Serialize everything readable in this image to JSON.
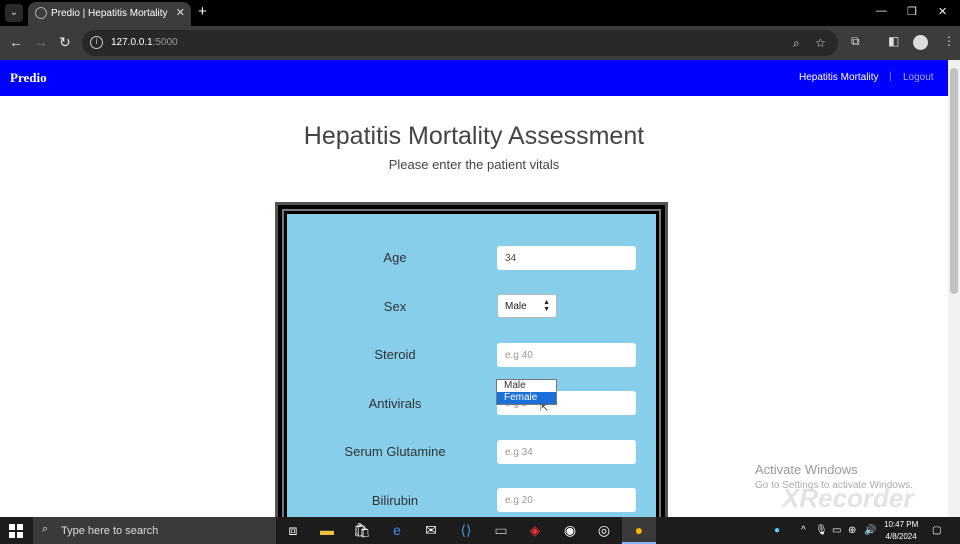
{
  "browser": {
    "tab_title": "Predio | Hepatitis Mortality Assessment",
    "url_host": "127.0.0.1",
    "url_port": ":5000",
    "new_tab": "+",
    "close": "✕"
  },
  "navbar": {
    "brand": "Predio",
    "link_assessment": "Hepatitis Mortality",
    "separator": "|",
    "link_logout": "Logout"
  },
  "page": {
    "title": "Hepatitis Mortality Assessment",
    "subtitle": "Please enter the patient vitals"
  },
  "form": {
    "age": {
      "label": "Age",
      "value": "34"
    },
    "sex": {
      "label": "Sex",
      "selected": "Male",
      "options": [
        "Male",
        "Female"
      ],
      "highlighted": "Female"
    },
    "steroid": {
      "label": "Steroid",
      "placeholder": "e.g 40"
    },
    "antivirals": {
      "label": "Antivirals",
      "placeholder": "e.g 5"
    },
    "serum_glutamine": {
      "label": "Serum Glutamine",
      "placeholder": "e.g 34"
    },
    "bilirubin": {
      "label": "Bilirubin",
      "placeholder": "e.g 20"
    }
  },
  "watermark": {
    "activate_title": "Activate Windows",
    "activate_sub": "Go to Settings to activate Windows.",
    "recorder": "XRecorder"
  },
  "taskbar": {
    "search_placeholder": "Type here to search",
    "time": "10:47 PM",
    "date": "4/8/2024"
  }
}
